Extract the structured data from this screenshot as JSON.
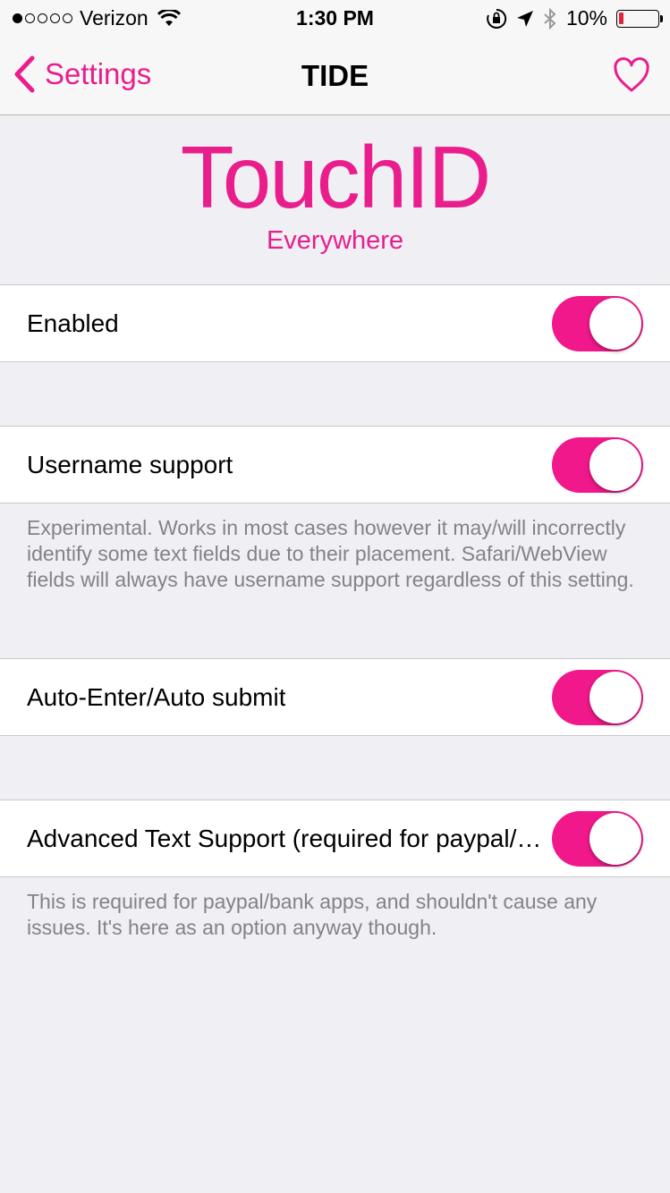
{
  "status_bar": {
    "carrier": "Verizon",
    "time": "1:30 PM",
    "battery": "10%",
    "icons": [
      "signal-dots",
      "wifi-icon",
      "orientation-lock-icon",
      "location-icon",
      "bluetooth-icon",
      "battery-icon"
    ]
  },
  "nav": {
    "back_label": "Settings",
    "title": "TIDE",
    "right_icon": "heart-icon"
  },
  "header": {
    "title": "TouchID",
    "subtitle": "Everywhere"
  },
  "colors": {
    "accent": "#e91e8c",
    "toggle_on": "#f0188a",
    "background": "#efeff4"
  },
  "settings": [
    {
      "label": "Enabled",
      "enabled": true
    },
    {
      "label": "Username support",
      "enabled": true,
      "footer": "Experimental. Works in most cases however it may/will incorrectly identify some text fields due to their placement. Safari/WebView fields will always have username support regardless of this setting."
    },
    {
      "label": "Auto-Enter/Auto submit",
      "enabled": true
    },
    {
      "label": "Advanced Text Support (required for paypal/bank apps)",
      "enabled": true,
      "footer": "This is required for paypal/bank apps, and shouldn't cause any issues. It's here as an option anyway though."
    }
  ]
}
